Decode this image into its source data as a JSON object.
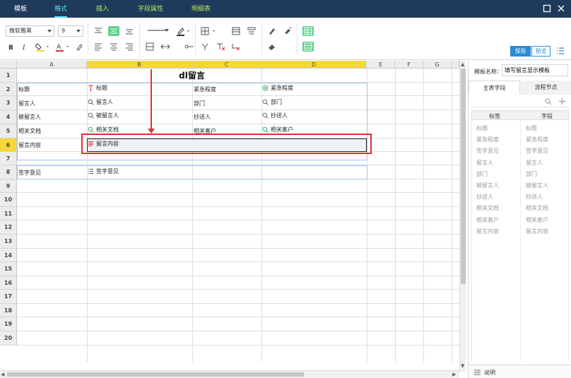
{
  "menu": {
    "tabs": [
      {
        "label": "模板"
      },
      {
        "label": "格式"
      },
      {
        "label": "插入"
      },
      {
        "label": "字段属性"
      },
      {
        "label": "明细表"
      }
    ]
  },
  "toolbar": {
    "font_family": "微软雅黑",
    "font_size": "9",
    "save_label": "保存",
    "preview_label": "预览"
  },
  "sheet": {
    "columns": [
      "A",
      "B",
      "C",
      "D",
      "E",
      "F",
      "G"
    ],
    "rows": [
      "1",
      "2",
      "3",
      "4",
      "5",
      "6",
      "7",
      "8",
      "9",
      "10",
      "11",
      "12",
      "13",
      "14",
      "15",
      "16",
      "17",
      "18",
      "19",
      "20"
    ],
    "title": "dl留言",
    "cells": [
      {
        "text": "标题"
      },
      {
        "text": "标题"
      },
      {
        "text": "紧急程度"
      },
      {
        "text": "紧急程度"
      },
      {
        "text": "留言人"
      },
      {
        "text": "留言人"
      },
      {
        "text": "部门"
      },
      {
        "text": "部门"
      },
      {
        "text": "被留言人"
      },
      {
        "text": "被留言人"
      },
      {
        "text": "抄送人"
      },
      {
        "text": "抄送人"
      },
      {
        "text": "相关文档"
      },
      {
        "text": "相关文档"
      },
      {
        "text": "相关客户"
      },
      {
        "text": "相关客户"
      },
      {
        "text": "留言内容"
      },
      {
        "text": "留言内容"
      },
      {
        "text": "签字意见"
      },
      {
        "text": "签字意见"
      }
    ]
  },
  "right_panel": {
    "template_name_label": "模板名称：",
    "template_name_value": "填写留言显示模板",
    "tabs": [
      {
        "label": "主表字段"
      },
      {
        "label": "流程节点"
      }
    ],
    "col_label": "标签",
    "col_field": "字段",
    "labels": [
      "标题",
      "紧急程度",
      "签字意见",
      "留言人",
      "部门",
      "被留言人",
      "抄送人",
      "相关文档",
      "相关客户",
      "留言内容"
    ],
    "fields": [
      "标题",
      "紧急程度",
      "签字意见",
      "留言人",
      "部门",
      "被留言人",
      "抄送人",
      "相关文档",
      "相关客户",
      "留言内容"
    ],
    "footer_label": "说明"
  },
  "colors": {
    "topbar": "#1f3a5a",
    "active_tab": "#5fe0ff",
    "selection": "#f5d73c",
    "annotation": "#e03030",
    "primary": "#2a8bd6"
  }
}
